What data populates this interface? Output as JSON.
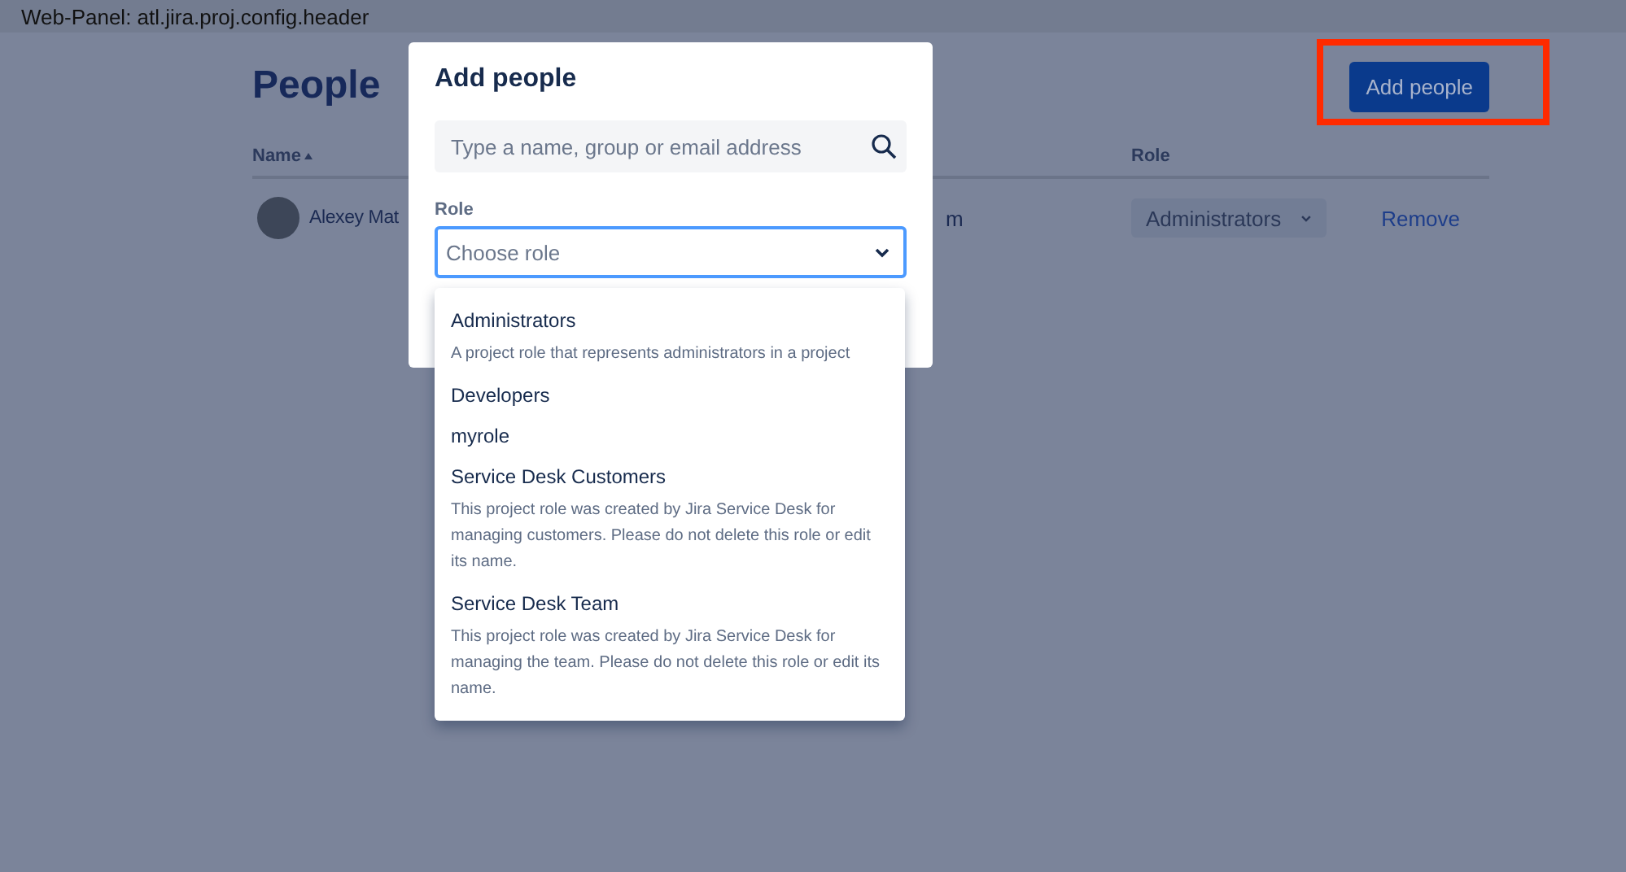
{
  "panel_label": "Web-Panel: atl.jira.proj.config.header",
  "page": {
    "title": "People",
    "add_button": {
      "label": "Add people",
      "highlighted": true
    }
  },
  "table": {
    "columns": [
      {
        "label": "Name",
        "sorted": true
      },
      {
        "label": "Role",
        "sorted": false
      }
    ],
    "rows": [
      {
        "name": "Alexey Mat",
        "column_2": "m",
        "role": "Administrators",
        "action": "Remove"
      }
    ]
  },
  "dialog": {
    "title": "Add people",
    "search": {
      "placeholder": "Type a name, group or email address"
    },
    "role_label": "Role",
    "role_select": {
      "placeholder": "Choose role",
      "expanded": true
    },
    "options": [
      {
        "name": "Administrators",
        "description": "A project role that represents administrators in a project"
      },
      {
        "name": "Developers"
      },
      {
        "name": "myrole"
      },
      {
        "name": "Service Desk Customers",
        "description": "This project role was created by Jira Service Desk for managing customers. Please do not delete this role or edit its name."
      },
      {
        "name": "Service Desk Team",
        "description": "This project role was created by Jira Service Desk for managing the team. Please do not delete this role or edit its name."
      }
    ]
  }
}
